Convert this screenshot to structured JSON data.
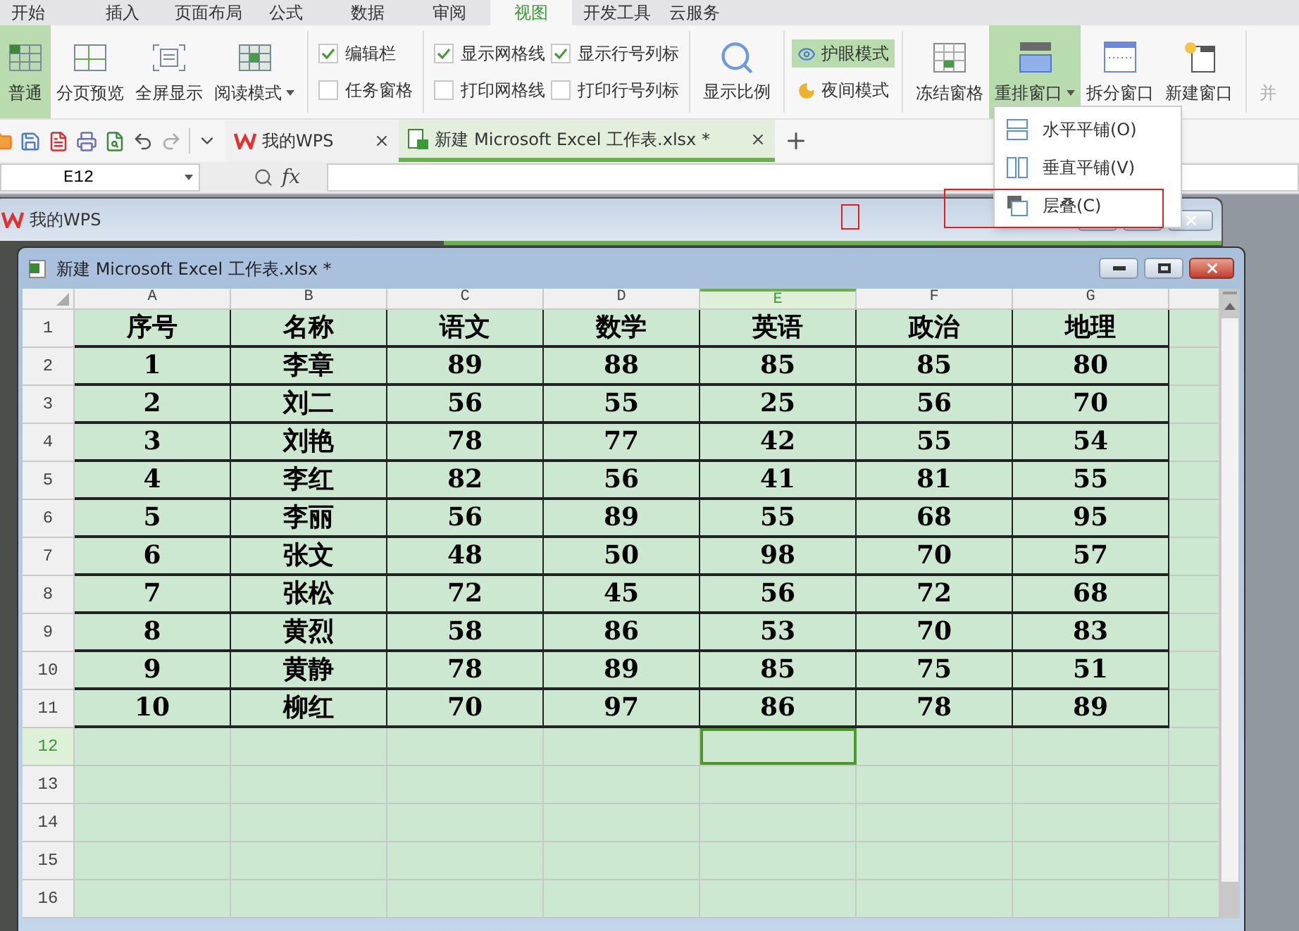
{
  "menu_tabs": [
    {
      "label": "开始",
      "selected": false
    },
    {
      "label": "插入",
      "selected": false
    },
    {
      "label": "页面布局",
      "selected": false
    },
    {
      "label": "公式",
      "selected": false
    },
    {
      "label": "数据",
      "selected": false
    },
    {
      "label": "审阅",
      "selected": false
    },
    {
      "label": "视图",
      "selected": true
    },
    {
      "label": "开发工具",
      "selected": false
    },
    {
      "label": "云服务",
      "selected": false
    }
  ],
  "ribbon": {
    "view_buttons": [
      {
        "label": "普通",
        "selected": true,
        "dropdown": false
      },
      {
        "label": "分页预览",
        "selected": false,
        "dropdown": false
      },
      {
        "label": "全屏显示",
        "selected": false,
        "dropdown": false
      },
      {
        "label": "阅读模式",
        "selected": false,
        "dropdown": true
      }
    ],
    "checkbox_columns": [
      [
        {
          "label": "编辑栏",
          "checked": true
        },
        {
          "label": "任务窗格",
          "checked": false
        }
      ],
      [
        {
          "label": "显示网格线",
          "checked": true
        },
        {
          "label": "打印网格线",
          "checked": false
        }
      ],
      [
        {
          "label": "显示行号列标",
          "checked": true
        },
        {
          "label": "打印行号列标",
          "checked": false
        }
      ]
    ],
    "zoom_button": {
      "label": "显示比例"
    },
    "modes": [
      {
        "label": "护眼模式",
        "on": true
      },
      {
        "label": "夜间模式",
        "on": false
      }
    ],
    "window_buttons": [
      {
        "label": "冻结窗格",
        "selected": false,
        "dropdown": false
      },
      {
        "label": "重排窗口",
        "selected": true,
        "dropdown": true
      },
      {
        "label": "拆分窗口",
        "selected": false,
        "dropdown": false
      },
      {
        "label": "新建窗口",
        "selected": false,
        "dropdown": false
      }
    ],
    "cut_button": {
      "label": "并"
    }
  },
  "doc_tabs": [
    {
      "label": "我的WPS",
      "selected": false
    },
    {
      "label": "新建 Microsoft Excel 工作表.xlsx *",
      "selected": true
    }
  ],
  "formula_bar": {
    "name_box": "E12",
    "fx": "fx"
  },
  "dropdown_menu": {
    "items": [
      {
        "label": "水平平铺(O)"
      },
      {
        "label": "垂直平铺(V)"
      },
      {
        "label": "层叠(C)"
      }
    ]
  },
  "back_window": {
    "title": "我的WPS"
  },
  "sheet_window": {
    "title": "新建 Microsoft Excel 工作表.xlsx *",
    "columns": [
      {
        "label": "A",
        "selected": false
      },
      {
        "label": "B",
        "selected": false
      },
      {
        "label": "C",
        "selected": false
      },
      {
        "label": "D",
        "selected": false
      },
      {
        "label": "E",
        "selected": true
      },
      {
        "label": "F",
        "selected": false
      },
      {
        "label": "G",
        "selected": false
      }
    ],
    "rows": [
      {
        "label": "1",
        "selected": false,
        "cells": [
          "序号",
          "名称",
          "语文",
          "数学",
          "英语",
          "政治",
          "地理"
        ]
      },
      {
        "label": "2",
        "selected": false,
        "cells": [
          "1",
          "李章",
          "89",
          "88",
          "85",
          "85",
          "80"
        ]
      },
      {
        "label": "3",
        "selected": false,
        "cells": [
          "2",
          "刘二",
          "56",
          "55",
          "25",
          "56",
          "70"
        ]
      },
      {
        "label": "4",
        "selected": false,
        "cells": [
          "3",
          "刘艳",
          "78",
          "77",
          "42",
          "55",
          "54"
        ]
      },
      {
        "label": "5",
        "selected": false,
        "cells": [
          "4",
          "李红",
          "82",
          "56",
          "41",
          "81",
          "55"
        ]
      },
      {
        "label": "6",
        "selected": false,
        "cells": [
          "5",
          "李丽",
          "56",
          "89",
          "55",
          "68",
          "95"
        ]
      },
      {
        "label": "7",
        "selected": false,
        "cells": [
          "6",
          "张文",
          "48",
          "50",
          "98",
          "70",
          "57"
        ]
      },
      {
        "label": "8",
        "selected": false,
        "cells": [
          "7",
          "张松",
          "72",
          "45",
          "56",
          "72",
          "68"
        ]
      },
      {
        "label": "9",
        "selected": false,
        "cells": [
          "8",
          "黄烈",
          "58",
          "86",
          "53",
          "70",
          "83"
        ]
      },
      {
        "label": "10",
        "selected": false,
        "cells": [
          "9",
          "黄静",
          "78",
          "89",
          "85",
          "75",
          "51"
        ]
      },
      {
        "label": "11",
        "selected": false,
        "cells": [
          "10",
          "柳红",
          "70",
          "97",
          "86",
          "78",
          "89"
        ]
      },
      {
        "label": "12",
        "selected": true
      },
      {
        "label": "13",
        "selected": false
      },
      {
        "label": "14",
        "selected": false
      },
      {
        "label": "15",
        "selected": false
      },
      {
        "label": "16",
        "selected": false
      }
    ]
  }
}
